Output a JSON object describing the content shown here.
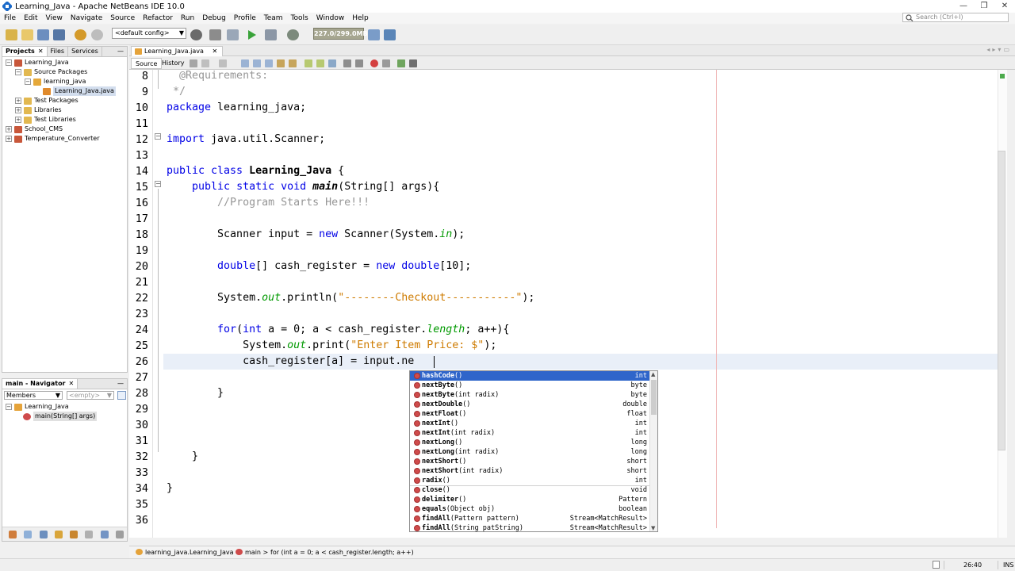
{
  "window": {
    "title": "Learning_Java - Apache NetBeans IDE 10.0",
    "min": "—",
    "max": "❐",
    "close": "✕"
  },
  "menu": [
    "File",
    "Edit",
    "View",
    "Navigate",
    "Source",
    "Refactor",
    "Run",
    "Debug",
    "Profile",
    "Team",
    "Tools",
    "Window",
    "Help"
  ],
  "search": {
    "placeholder": "Search (Ctrl+I)"
  },
  "toolbar": {
    "config": "<default config>",
    "memory": "227.0/299.0MB"
  },
  "projects": {
    "tabs": [
      "Projects",
      "Files",
      "Services"
    ],
    "tree": [
      {
        "label": "Learning_Java",
        "level": 0,
        "toggle": "−",
        "icon": "project"
      },
      {
        "label": "Source Packages",
        "level": 1,
        "toggle": "−",
        "icon": "folder"
      },
      {
        "label": "learning_java",
        "level": 2,
        "toggle": "−",
        "icon": "package"
      },
      {
        "label": "Learning_Java.java",
        "level": 3,
        "toggle": "",
        "icon": "java-file",
        "selected": true
      },
      {
        "label": "Test Packages",
        "level": 1,
        "toggle": "+",
        "icon": "folder"
      },
      {
        "label": "Libraries",
        "level": 1,
        "toggle": "+",
        "icon": "folder"
      },
      {
        "label": "Test Libraries",
        "level": 1,
        "toggle": "+",
        "icon": "folder"
      },
      {
        "label": "School_CMS",
        "level": 0,
        "toggle": "+",
        "icon": "project"
      },
      {
        "label": "Temperature_Converter",
        "level": 0,
        "toggle": "+",
        "icon": "project"
      }
    ]
  },
  "navigator": {
    "title": "main - Navigator",
    "filter": "Members",
    "empty": "<empty>",
    "tree": [
      {
        "label": "Learning_Java",
        "level": 0,
        "toggle": "−"
      },
      {
        "label": "main(String[] args)",
        "level": 1,
        "toggle": ""
      }
    ]
  },
  "editor": {
    "file_tab": "Learning_Java.java",
    "source_tab": "Source",
    "history_tab": "History",
    "line_numbers": [
      8,
      9,
      10,
      11,
      12,
      13,
      14,
      15,
      16,
      17,
      18,
      19,
      20,
      21,
      22,
      23,
      24,
      25,
      26,
      27,
      28,
      29,
      30,
      31,
      32,
      33,
      34,
      35,
      36
    ]
  },
  "completion": {
    "items": [
      {
        "name": "hashCode",
        "params": "()",
        "type": "int",
        "selected": true
      },
      {
        "name": "nextByte",
        "params": "()",
        "type": "byte"
      },
      {
        "name": "nextByte",
        "params": "(int radix)",
        "type": "byte"
      },
      {
        "name": "nextDouble",
        "params": "()",
        "type": "double"
      },
      {
        "name": "nextFloat",
        "params": "()",
        "type": "float"
      },
      {
        "name": "nextInt",
        "params": "()",
        "type": "int"
      },
      {
        "name": "nextInt",
        "params": "(int radix)",
        "type": "int"
      },
      {
        "name": "nextLong",
        "params": "()",
        "type": "long"
      },
      {
        "name": "nextLong",
        "params": "(int radix)",
        "type": "long"
      },
      {
        "name": "nextShort",
        "params": "()",
        "type": "short"
      },
      {
        "name": "nextShort",
        "params": "(int radix)",
        "type": "short"
      },
      {
        "name": "radix",
        "params": "()",
        "type": "int"
      },
      {
        "name": "close",
        "params": "()",
        "type": "void"
      },
      {
        "name": "delimiter",
        "params": "()",
        "type": "Pattern"
      },
      {
        "name": "equals",
        "params": "(Object obj)",
        "type": "boolean"
      },
      {
        "name": "findAll",
        "params": "(Pattern pattern)",
        "type": "Stream<MatchResult>"
      },
      {
        "name": "findAll",
        "params": "(String patString)",
        "type": "Stream<MatchResult>"
      }
    ]
  },
  "breadcrumbs": [
    "learning_java.Learning_Java",
    "main",
    "for (int a = 0; a < cash_register.length; a++)"
  ],
  "status": {
    "position": "26:40",
    "mode": "INS"
  },
  "colors": {
    "keyword": "#0000e6",
    "string": "#ce7b00",
    "comment": "#969696",
    "selection": "#2f65ca"
  }
}
